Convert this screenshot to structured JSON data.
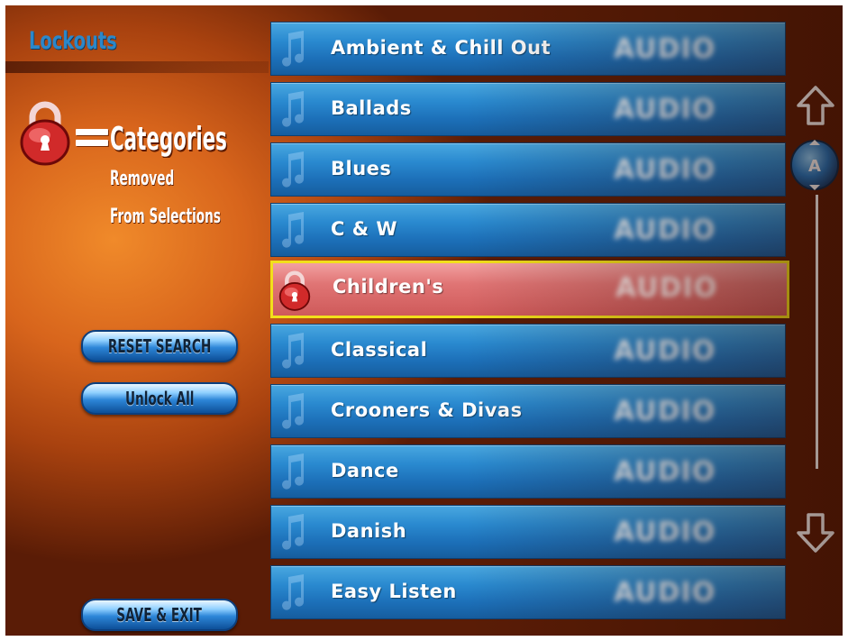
{
  "header": {
    "title": "Lockouts"
  },
  "legend": {
    "equals_sign": "=",
    "word": "Categories",
    "line1": "Removed",
    "line2": "From Selections"
  },
  "buttons": {
    "reset_search": "RESET SEARCH",
    "unlock_all": "Unlock All",
    "save_exit": "SAVE & EXIT"
  },
  "categories": [
    {
      "name": "Ambient & Chill Out",
      "type": "AUDIO",
      "locked": false
    },
    {
      "name": "Ballads",
      "type": "AUDIO",
      "locked": false
    },
    {
      "name": "Blues",
      "type": "AUDIO",
      "locked": false
    },
    {
      "name": "C & W",
      "type": "AUDIO",
      "locked": false
    },
    {
      "name": "Children's",
      "type": "AUDIO",
      "locked": true
    },
    {
      "name": "Classical",
      "type": "AUDIO",
      "locked": false
    },
    {
      "name": "Crooners & Divas",
      "type": "AUDIO",
      "locked": false
    },
    {
      "name": "Dance",
      "type": "AUDIO",
      "locked": false
    },
    {
      "name": "Danish",
      "type": "AUDIO",
      "locked": false
    },
    {
      "name": "Easy Listen",
      "type": "AUDIO",
      "locked": false
    }
  ],
  "scrollbar": {
    "thumb_letter": "A"
  },
  "icons": {
    "lock": "lock-icon",
    "note": "music-note-icon",
    "up": "arrow-up-icon",
    "down": "arrow-down-icon"
  },
  "colors": {
    "row_blue": "#2a8ad0",
    "row_locked": "#e07474",
    "highlight_border": "#f2df1b",
    "title_blue": "#2c87c9"
  }
}
